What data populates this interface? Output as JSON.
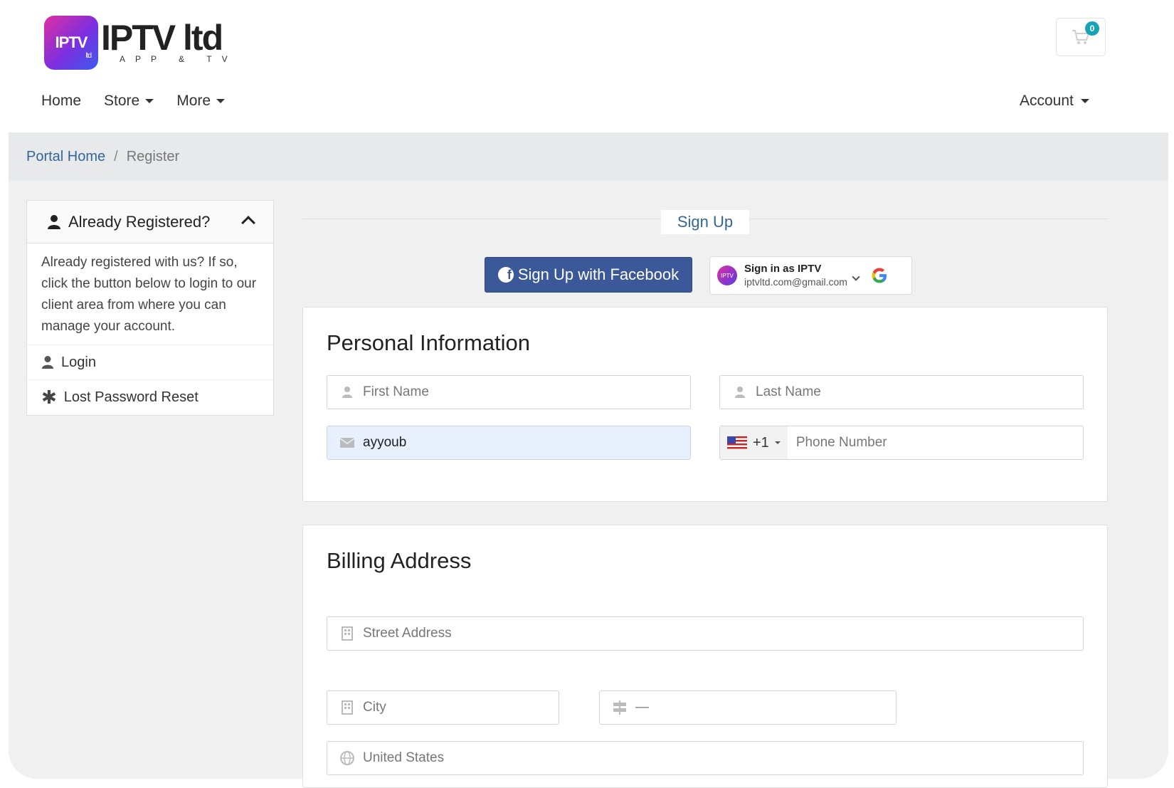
{
  "header": {
    "logo_main": "IPTV ltd",
    "logo_tag": "APP & TV",
    "logo_badge_text": "IPTV",
    "logo_badge_sub": "ltd",
    "cart_count": "0"
  },
  "nav": {
    "items": [
      {
        "label": "Home"
      },
      {
        "label": "Store"
      },
      {
        "label": "More"
      }
    ],
    "account_label": "Account"
  },
  "breadcrumb": {
    "home": "Portal Home",
    "separator": "/",
    "current": "Register"
  },
  "sidebar": {
    "title": "Already Registered?",
    "body": "Already registered with us? If so, click the button below to login to our client area from where you can manage your account.",
    "links": [
      {
        "label": "Login"
      },
      {
        "label": "Lost Password Reset"
      }
    ]
  },
  "signup": {
    "title": "Sign Up",
    "facebook_label": "Sign Up with Facebook",
    "google_name": "Sign in as IPTV",
    "google_email": "iptvltd.com@gmail.com"
  },
  "personal": {
    "heading": "Personal Information",
    "first_name_placeholder": "First Name",
    "last_name_placeholder": "Last Name",
    "email_value": "ayyoub",
    "phone_code": "+1",
    "phone_placeholder": "Phone Number"
  },
  "billing": {
    "heading": "Billing Address",
    "street_placeholder": "Street Address",
    "city_placeholder": "City",
    "state_value": "—",
    "country_value": "United States"
  },
  "colors": {
    "link": "#336699",
    "facebook": "#3b5998",
    "badge": "#17a2b8"
  }
}
